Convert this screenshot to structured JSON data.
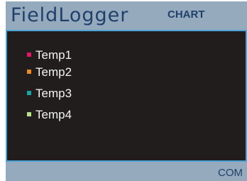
{
  "header": {
    "logo_text": "FieldLogger",
    "mode_label": "CHART"
  },
  "legend": {
    "items": [
      {
        "label": "Temp1",
        "color": "#e0166b"
      },
      {
        "label": "Temp2",
        "color": "#f08a24"
      },
      {
        "label": "Temp3",
        "color": "#1aa3a3"
      },
      {
        "label": "Temp4",
        "color": "#b9e08c"
      }
    ]
  },
  "footer": {
    "status_label": "COM"
  },
  "colors": {
    "frame": "#95aabd",
    "screen": "#211d1d",
    "screen_border": "#4fa3d6",
    "brand_text": "#21406b"
  }
}
